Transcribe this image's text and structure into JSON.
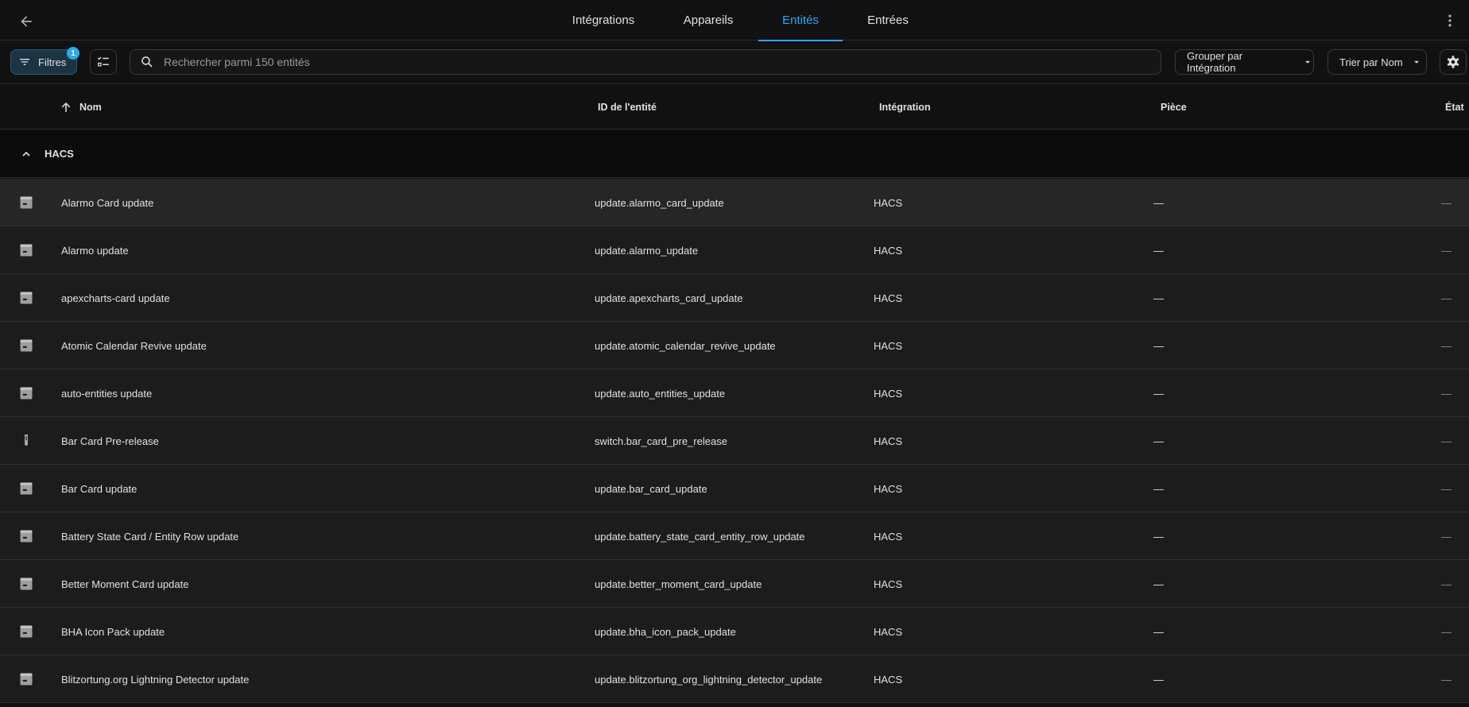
{
  "tabs": [
    {
      "label": "Intégrations",
      "active": false
    },
    {
      "label": "Appareils",
      "active": false
    },
    {
      "label": "Entités",
      "active": true
    },
    {
      "label": "Entrées",
      "active": false
    }
  ],
  "toolbar": {
    "filters_label": "Filtres",
    "filters_badge": "1",
    "search_placeholder": "Rechercher parmi 150 entités",
    "group_label": "Grouper par Intégration",
    "sort_label": "Trier par Nom"
  },
  "columns": {
    "name": "Nom",
    "entity_id": "ID de l'entité",
    "integration": "Intégration",
    "area": "Pièce",
    "state": "État"
  },
  "group": {
    "name": "HACS"
  },
  "rows": [
    {
      "icon": "package-icon",
      "name": "Alarmo Card update",
      "entity_id": "update.alarmo_card_update",
      "integration": "HACS",
      "area": "—",
      "state": "—"
    },
    {
      "icon": "package-icon",
      "name": "Alarmo update",
      "entity_id": "update.alarmo_update",
      "integration": "HACS",
      "area": "—",
      "state": "—"
    },
    {
      "icon": "package-icon",
      "name": "apexcharts-card update",
      "entity_id": "update.apexcharts_card_update",
      "integration": "HACS",
      "area": "—",
      "state": "—"
    },
    {
      "icon": "package-icon",
      "name": "Atomic Calendar Revive update",
      "entity_id": "update.atomic_calendar_revive_update",
      "integration": "HACS",
      "area": "—",
      "state": "—"
    },
    {
      "icon": "package-icon",
      "name": "auto-entities update",
      "entity_id": "update.auto_entities_update",
      "integration": "HACS",
      "area": "—",
      "state": "—"
    },
    {
      "icon": "test-tube-icon",
      "name": "Bar Card Pre-release",
      "entity_id": "switch.bar_card_pre_release",
      "integration": "HACS",
      "area": "—",
      "state": "—"
    },
    {
      "icon": "package-icon",
      "name": "Bar Card update",
      "entity_id": "update.bar_card_update",
      "integration": "HACS",
      "area": "—",
      "state": "—"
    },
    {
      "icon": "package-icon",
      "name": "Battery State Card / Entity Row update",
      "entity_id": "update.battery_state_card_entity_row_update",
      "integration": "HACS",
      "area": "—",
      "state": "—"
    },
    {
      "icon": "package-icon",
      "name": "Better Moment Card update",
      "entity_id": "update.better_moment_card_update",
      "integration": "HACS",
      "area": "—",
      "state": "—"
    },
    {
      "icon": "package-icon",
      "name": "BHA Icon Pack update",
      "entity_id": "update.bha_icon_pack_update",
      "integration": "HACS",
      "area": "—",
      "state": "—"
    },
    {
      "icon": "package-icon",
      "name": "Blitzortung.org Lightning Detector update",
      "entity_id": "update.blitzortung_org_lightning_detector_update",
      "integration": "HACS",
      "area": "—",
      "state": "—"
    }
  ]
}
